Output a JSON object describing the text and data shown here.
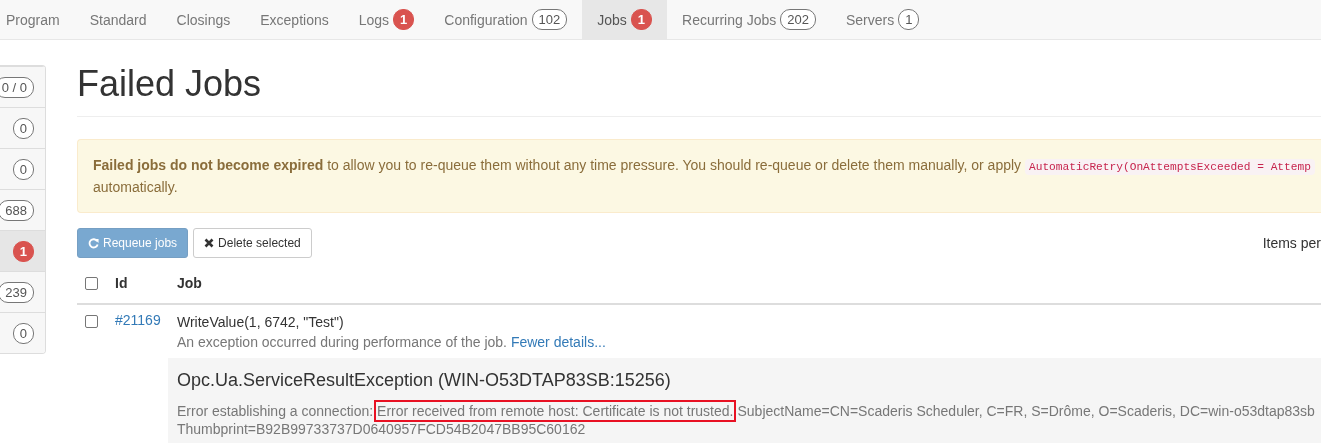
{
  "tabs": [
    {
      "label": "Program",
      "selected": false
    },
    {
      "label": "Standard",
      "selected": false
    },
    {
      "label": "Closings",
      "selected": false
    },
    {
      "label": "Exceptions",
      "selected": false
    },
    {
      "label": "Logs",
      "badge": "1",
      "alert": true,
      "selected": false
    },
    {
      "label": "Configuration",
      "badge": "102",
      "alert": false,
      "selected": false
    },
    {
      "label": "Jobs",
      "badge": "1",
      "alert": true,
      "selected": true
    },
    {
      "label": "Recurring Jobs",
      "badge": "202",
      "alert": false,
      "selected": false
    },
    {
      "label": "Servers",
      "badge": "1",
      "alert": false,
      "selected": false
    }
  ],
  "sidebar": {
    "items": [
      {
        "badge": "0 / 0",
        "alert": false,
        "selected": false
      },
      {
        "badge": "0",
        "alert": false,
        "selected": false
      },
      {
        "badge": "0",
        "alert": false,
        "selected": false
      },
      {
        "badge": "688",
        "alert": false,
        "selected": false
      },
      {
        "badge": "1",
        "alert": true,
        "selected": true
      },
      {
        "badge": "239",
        "alert": false,
        "selected": false
      },
      {
        "badge": "0",
        "alert": false,
        "selected": false
      }
    ]
  },
  "page": {
    "title": "Failed Jobs",
    "alert": {
      "text": "**Failed jobs do not become expired** to allow you to re-queue them without any time pressure. You should re-queue or delete them manually, or apply",
      "code": "AutomaticRetry(OnAttemptsExceeded = Attemp",
      "text_end": "automatically."
    },
    "toolbar": {
      "requeue_button": "Requeue jobs",
      "requeue_disabled": true,
      "delete_button": "Delete selected",
      "items_per_page": "Items per"
    },
    "table": {
      "columns": [
        "Id",
        "Job"
      ],
      "header_checked": false,
      "rows": [
        {
          "checked": false,
          "id": "#21169",
          "job": "WriteValue(1, 6742, \"Test\")",
          "message": "An exception occurred during performance of the job.",
          "details_link": "Fewer details...",
          "exception": {
            "title": "Opc.Ua.ServiceResultException (WIN-O53DTAP83SB:15256)",
            "parts": [
              {
                "text": "Error establishing a connection:",
                "highlighted": false
              },
              {
                "text": "Error received from remote host: Certificate is not trusted.",
                "highlighted": true
              },
              {
                "text": "SubjectName=CN=Scaderis Scheduler, C=FR, S=Drôme, O=Scaderis, DC=win-o53dtap83sb",
                "highlighted": false
              }
            ],
            "line_2": "Thumbprint=B92B99733737D0640957FCD54B2047BB95C60162"
          }
        }
      ]
    }
  }
}
